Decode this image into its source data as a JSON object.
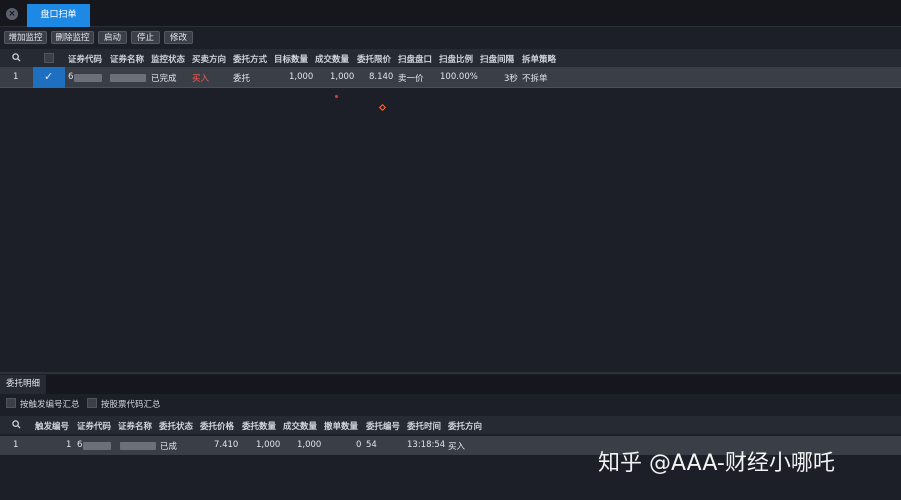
{
  "window": {
    "close_glyph": "×",
    "active_tab": "盘口扫单"
  },
  "toolbar": {
    "add_label": "增加监控",
    "delete_label": "删除监控",
    "start_label": "启动",
    "stop_label": "停止",
    "edit_label": "修改"
  },
  "monitor_table": {
    "columns": [
      "证券代码",
      "证券名称",
      "监控状态",
      "买卖方向",
      "委托方式",
      "目标数量",
      "成交数量",
      "委托限价",
      "扫盘盘口",
      "扫盘比例",
      "扫盘间隔",
      "拆单策略"
    ],
    "row": {
      "index": "1",
      "code_prefix": "6",
      "status": "已完成",
      "side": "买入",
      "order_type": "委托",
      "target_qty": "1,000",
      "filled_qty": "1,000",
      "limit_price": "8.140",
      "level": "卖一价",
      "ratio": "100.00%",
      "interval": "3秒",
      "split": "不拆单"
    }
  },
  "lower": {
    "tab": "委托明细",
    "opt_trigger": "按触发编号汇总",
    "opt_code": "按股票代码汇总",
    "columns": [
      "触发编号",
      "证券代码",
      "证券名称",
      "委托状态",
      "委托价格",
      "委托数量",
      "成交数量",
      "撤单数量",
      "委托编号",
      "委托时间",
      "委托方向"
    ],
    "row": {
      "index": "1",
      "trigger": "1",
      "code_prefix": "6",
      "status": "已成",
      "price": "7.410",
      "qty": "1,000",
      "filled": "1,000",
      "cancel": "0",
      "order_no": "54",
      "time": "13:18:54",
      "side": "买入"
    }
  },
  "watermark": "知乎 @AAA-财经小哪吒",
  "colors": {
    "accent": "#1e88e5",
    "buy": "#ff5a4f"
  }
}
